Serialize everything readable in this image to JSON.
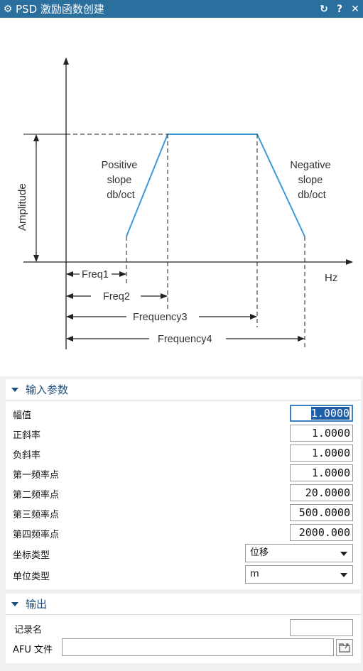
{
  "title_bar": {
    "title": "PSD 激励函数创建",
    "icons": [
      "gear-icon",
      "reset-icon",
      "help-icon",
      "close-icon"
    ],
    "reset_glyph": "↻",
    "help_glyph": "?",
    "close_glyph": "✕",
    "gear_glyph": "⚙",
    "bg_color": "#2a6f9e"
  },
  "diagram": {
    "y_axis_label": "Amplitude",
    "x_axis_unit": "Hz",
    "positive_slope": [
      "Positive",
      "slope",
      "db/oct"
    ],
    "negative_slope": [
      "Negative",
      "slope",
      "db/oct"
    ],
    "freq_labels": [
      "Freq1",
      "Freq2",
      "Frequency3",
      "Frequency4"
    ]
  },
  "params": {
    "section_title": "输入参数",
    "fields": [
      {
        "label": "幅值",
        "value": "1.0000"
      },
      {
        "label": "正斜率",
        "value": "1.0000"
      },
      {
        "label": "负斜率",
        "value": "1.0000"
      },
      {
        "label": "第一频率点",
        "value": "1.0000"
      },
      {
        "label": "第二频率点",
        "value": "20.0000"
      },
      {
        "label": "第三频率点",
        "value": "500.0000"
      },
      {
        "label": "第四频率点",
        "value": "2000.000"
      }
    ],
    "coord_type": {
      "label": "坐标类型",
      "value": "位移"
    },
    "unit_type": {
      "label": "单位类型",
      "value": "m"
    }
  },
  "output": {
    "section_title": "输出",
    "record_name_label": "记录名",
    "record_name_value": "",
    "afu_label": "AFU 文件",
    "afu_value": ""
  }
}
